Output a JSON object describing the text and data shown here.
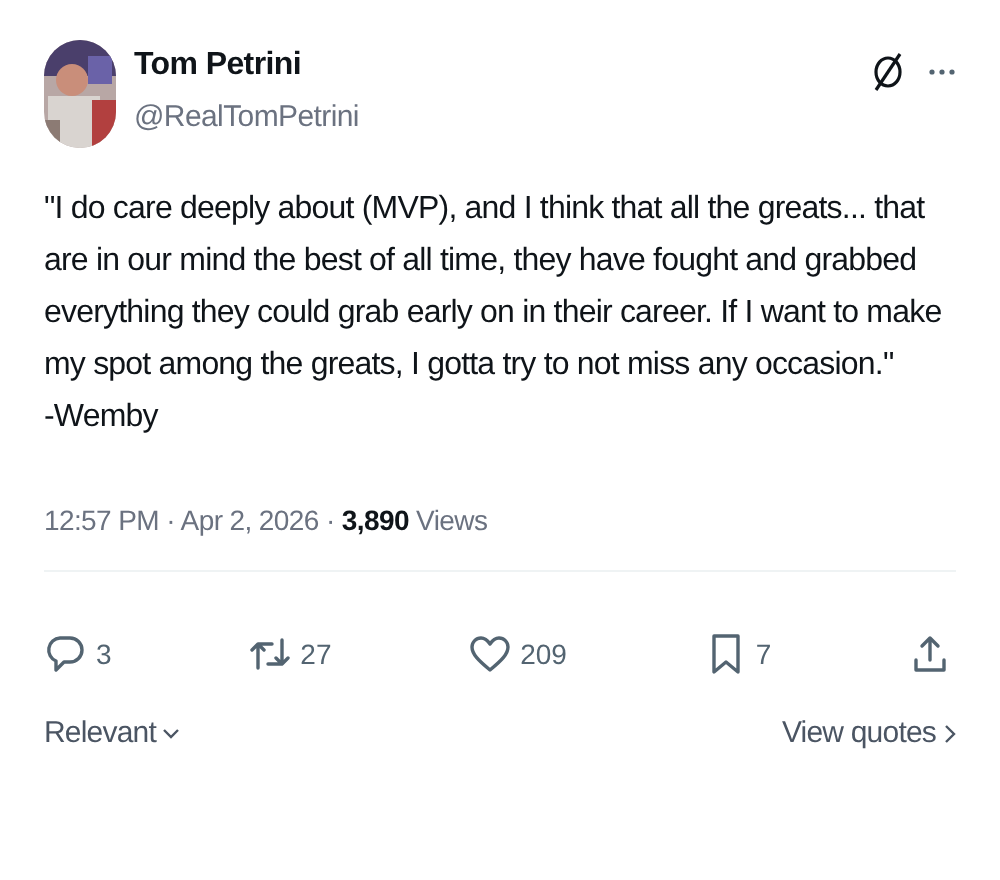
{
  "author": {
    "name": "Tom Petrini",
    "handle": "@RealTomPetrini"
  },
  "post": {
    "quote": "\"I do care deeply about (MVP), and I think that all the greats... that are in our mind the best of all time, they have fought and grabbed everything they could grab early on in their career. If I want to make my spot among the greats, I gotta try to not miss any occasion.\"",
    "attribution": "-Wemby"
  },
  "meta": {
    "time": "12:57 PM · Apr 2, 2026 · ",
    "views_count": "3,890",
    "views_label": " Views"
  },
  "actions": [
    {
      "kind": "reply",
      "count": "3"
    },
    {
      "kind": "repost",
      "count": "27"
    },
    {
      "kind": "like",
      "count": "209"
    },
    {
      "kind": "bookmark",
      "count": "7"
    },
    {
      "kind": "share"
    }
  ],
  "footer": {
    "sort": "Relevant",
    "link": "View quotes"
  }
}
